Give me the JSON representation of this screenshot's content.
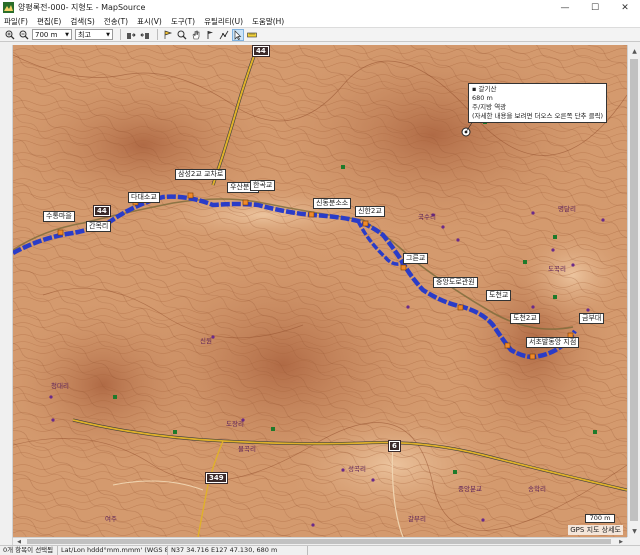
{
  "window": {
    "title": "양평록전-000- 지형도 - MapSource",
    "minimize": "—",
    "maximize": "☐",
    "close": "✕"
  },
  "menu": [
    "파일(F)",
    "편집(E)",
    "검색(S)",
    "전송(T)",
    "표시(V)",
    "도구(T)",
    "유틸리티(U)",
    "도움말(H)"
  ],
  "toolbar": {
    "zoom_value": "700 m",
    "detail_value": "최고"
  },
  "map": {
    "waypoint_popup": {
      "name": "갈기산",
      "elevation": "680 m",
      "type": "주/지방 역광",
      "hint": "(자세한 내용을 보려면 더오스 오른쪽 단추 클릭)"
    },
    "route_labels": [
      "수통마을",
      "간목리",
      "다대소교",
      "삼성2교 교차로",
      "우산분교",
      "한곡교",
      "신동분소소",
      "신한2교",
      "그른교",
      "중앙도로관원",
      "도천교",
      "도천2교",
      "서초발동앙 지점",
      "금부대"
    ],
    "road_shields": [
      "44",
      "44",
      "6",
      "349"
    ],
    "place_labels": [
      "신원",
      "청대리",
      "도장리",
      "물곡리",
      "성곡리",
      "국수리",
      "중앙분교",
      "명달리",
      "도곡리",
      "여주",
      "갈부리",
      "송학리"
    ],
    "scale": "700 m",
    "gps_link": "GPS 지도 상세도"
  },
  "status": {
    "selection": "0개 항목이 선택됨",
    "format": "Lat/Lon hddd°mm.mmm' (WGS 84)",
    "coords": "N37 34.716 E127 47.130, 680 m"
  },
  "colors": {
    "terrain": "#d49a6e",
    "contour": "#a8623a",
    "route": "#2a3cc8",
    "road": "#e0b12a"
  }
}
